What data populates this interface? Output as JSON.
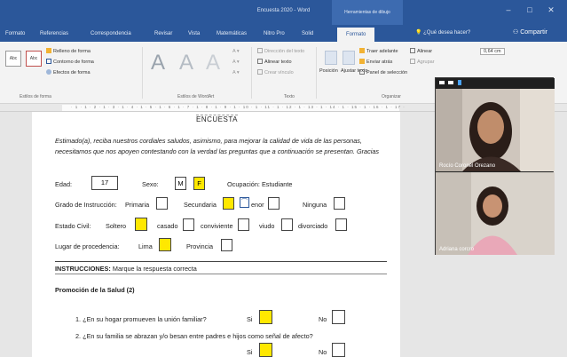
{
  "window": {
    "title": "Encuesta 2020 - Word",
    "contextual_tools": "Herramientas de dibujo"
  },
  "tabs": [
    {
      "label": "Formato"
    },
    {
      "label": "Referencias"
    },
    {
      "label": "Correspondencia"
    },
    {
      "label": "Revisar"
    },
    {
      "label": "Vista"
    },
    {
      "label": "Matemáticas"
    },
    {
      "label": "Nitro Pro"
    },
    {
      "label": "Solid"
    },
    {
      "label": "Formato",
      "active": true
    }
  ],
  "tell_me": "¿Qué desea hacer?",
  "share": "Compartir",
  "ribbon": {
    "shape_fill": "Relleno de forma",
    "shape_outline": "Contorno de forma",
    "shape_effects": "Efectos de forma",
    "text_direction": "Dirección del texto",
    "align_text": "Alinear texto",
    "create_link": "Crear vínculo",
    "bring_forward": "Traer adelante",
    "send_backward": "Enviar atrás",
    "selection_pane": "Panel de selección",
    "align": "Alinear",
    "group": "Agrupar",
    "height_value": "0,64 cm",
    "position": "Posición",
    "wrap_text": "Ajustar texto",
    "group_labels": {
      "shape_styles": "Estilos de forma",
      "wordart_styles": "Estilos de WordArt",
      "text": "Texto",
      "arrange": "Organizar"
    },
    "style_button_label": "Abc"
  },
  "ruler": {
    "marks": "· 1 · 1 · 2 · 1 · 3 · 1 · 4 · 1 · 5 · 1 · 6 · 1 · 7 · 1 · 8 · 1 · 9 · 1 · 10 · 1 · 11 · 1 · 12 · 1 · 13 · 1 · 14 · 1 · 15 · 1 · 16 · 1 · 17 ·"
  },
  "document": {
    "heading": "ENCUESTA",
    "intro": "Estimado(a), reciba nuestros cordiales saludos, asimismo, para mejorar la calidad de vida de las personas, necesitamos que nos apoyen contestando con la verdad las preguntas que a continuación se presentan.  Gracias",
    "age_label": "Edad:",
    "age_value": "17",
    "sex_label": "Sexo:",
    "sex_m": "M",
    "sex_f": "F",
    "occupation": "Ocupación: Estudiante",
    "education_label": "Grado de Instrucción:",
    "primaria": "Primaria",
    "secundaria": "Secundaria",
    "menor": "enor",
    "ninguna": "Ninguna",
    "civil_label": "Estado Civil:",
    "soltero": "Soltero",
    "casado": "casado",
    "conviviente": "conviviente",
    "viudo": "viudo",
    "divorciado": "divorciado",
    "origin_label": "Lugar de procedencia:",
    "lima": "Lima",
    "provincia": "Provincia",
    "instructions_bold": "INSTRUCCIONES:",
    "instructions_text": " Marque la respuesta correcta",
    "section_title": "Promoción de la Salud (2)",
    "q1": "1.   ¿En su hogar promueven la unión familiar?",
    "q2": "2.   ¿En su familia se abrazan y/o besan entre padres e hijos como señal de afecto?",
    "si": "Si",
    "no": "No"
  },
  "video_call": {
    "participants": [
      {
        "name": "Rocío Coronel Orezano"
      },
      {
        "name": "Adriana corcro"
      }
    ]
  },
  "colors": {
    "word_blue": "#2b579a",
    "highlight_yellow": "#ffe800",
    "page_bg": "#ffffff",
    "doc_bg": "#e6e6e6"
  }
}
